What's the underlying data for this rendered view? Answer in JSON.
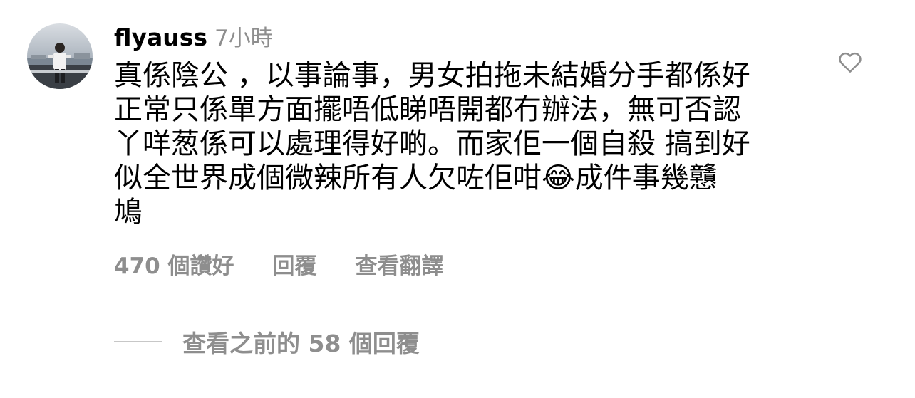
{
  "comment": {
    "avatar_icon": "user-photo-avatar",
    "username": "flyauss",
    "time": "7小時",
    "text": "真係陰公 ，以事論事，男女拍拖未結婚分手都係好\n正常只係單方面擺唔低睇唔開都冇辦法，無可否認\n丫咩葱係可以處理得好啲。而家佢一個自殺 搞到好\n似全世界成個微辣所有人欠咗佢咁😂成件事幾戇\n鳩",
    "like_icon": "heart-outline-icon"
  },
  "actions": {
    "likes": "470 個讚好",
    "reply": "回覆",
    "translate": "查看翻譯"
  },
  "view_replies": {
    "label": "查看之前的 58 個回覆"
  },
  "colors": {
    "primary_text": "#000000",
    "secondary_text": "#8e8e8e",
    "divider": "#c7c7c7",
    "background": "#ffffff"
  }
}
